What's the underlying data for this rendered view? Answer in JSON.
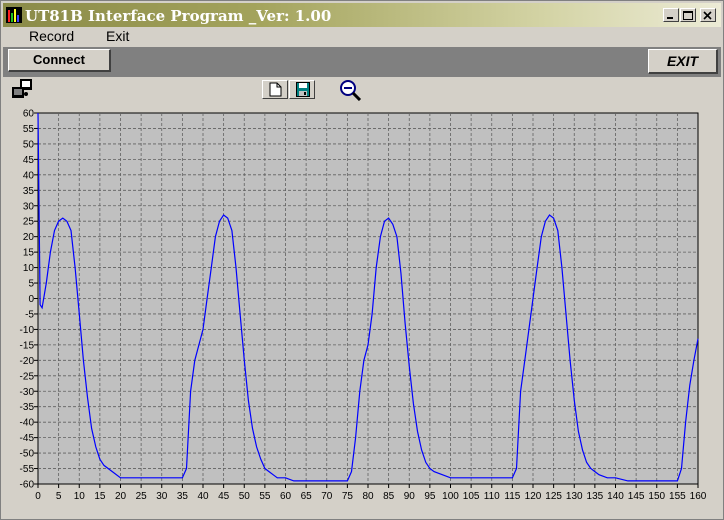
{
  "window": {
    "title": "UT81B Interface Program _Ver: 1.00"
  },
  "menu": {
    "items": [
      "Record",
      "Exit"
    ]
  },
  "toolbar": {
    "connect_label": "Connect",
    "exit_label": "EXIT"
  },
  "icons": [
    "network-status-icon",
    "new-document-icon",
    "save-disk-icon",
    "zoom-out-icon"
  ],
  "colors": {
    "title_gradient_start": "#8a8a48",
    "title_gradient_end": "#ecebd6",
    "plot_background": "#c0c0c0",
    "series_line": "#0000ff"
  },
  "chart_data": {
    "type": "line",
    "title": "",
    "xlabel": "",
    "ylabel": "",
    "xlim": [
      0,
      160
    ],
    "ylim": [
      -60,
      60
    ],
    "x_ticks": [
      0,
      5,
      10,
      15,
      20,
      25,
      30,
      35,
      40,
      45,
      50,
      55,
      60,
      65,
      70,
      75,
      80,
      85,
      90,
      95,
      100,
      105,
      110,
      115,
      120,
      125,
      130,
      135,
      140,
      145,
      150,
      155,
      160
    ],
    "y_ticks": [
      60,
      55,
      50,
      45,
      40,
      35,
      30,
      25,
      20,
      15,
      10,
      5,
      0,
      -5,
      -10,
      -15,
      -20,
      -25,
      -30,
      -35,
      -40,
      -45,
      -50,
      -55,
      -60
    ],
    "grid": true,
    "series": [
      {
        "x": [
          0,
          0.5,
          1,
          2,
          3,
          4,
          5,
          6,
          7,
          8,
          9,
          10,
          11,
          12,
          13,
          14,
          15,
          16,
          18,
          20,
          25,
          30,
          35,
          36,
          37,
          38,
          39,
          40,
          41,
          42,
          43,
          44,
          45,
          46,
          47,
          48,
          49,
          50,
          51,
          52,
          53,
          54,
          55,
          56,
          57,
          58,
          60,
          62,
          65,
          70,
          75,
          76,
          77,
          78,
          79,
          80,
          81,
          82,
          83,
          84,
          85,
          86,
          87,
          88,
          89,
          90,
          91,
          92,
          93,
          94,
          95,
          96,
          98,
          100,
          105,
          110,
          115,
          116,
          117,
          118,
          119,
          120,
          121,
          122,
          123,
          124,
          125,
          126,
          127,
          128,
          129,
          130,
          131,
          132,
          133,
          134,
          135,
          136,
          138,
          140,
          143,
          145,
          150,
          155,
          156,
          157,
          158,
          159,
          160
        ],
        "y": [
          60,
          -2,
          -3,
          5,
          15,
          22,
          25,
          26,
          25,
          22,
          10,
          -5,
          -20,
          -32,
          -42,
          -48,
          -52,
          -54,
          -56,
          -58,
          -58,
          -58,
          -58,
          -55,
          -30,
          -20,
          -15,
          -10,
          0,
          10,
          20,
          25,
          27,
          26,
          22,
          10,
          -5,
          -20,
          -33,
          -42,
          -48,
          -52,
          -55,
          -56,
          -57,
          -58,
          -58,
          -59,
          -59,
          -59,
          -59,
          -56,
          -45,
          -30,
          -20,
          -15,
          -5,
          10,
          20,
          25,
          26,
          24,
          20,
          8,
          -8,
          -22,
          -34,
          -43,
          -49,
          -53,
          -55,
          -56,
          -57,
          -58,
          -58,
          -58,
          -58,
          -55,
          -30,
          -20,
          -10,
          0,
          10,
          20,
          25,
          27,
          26,
          22,
          10,
          -5,
          -20,
          -33,
          -43,
          -49,
          -53,
          -55,
          -56,
          -57,
          -58,
          -58,
          -59,
          -59,
          -59,
          -59,
          -55,
          -40,
          -28,
          -20,
          -13
        ]
      }
    ]
  }
}
